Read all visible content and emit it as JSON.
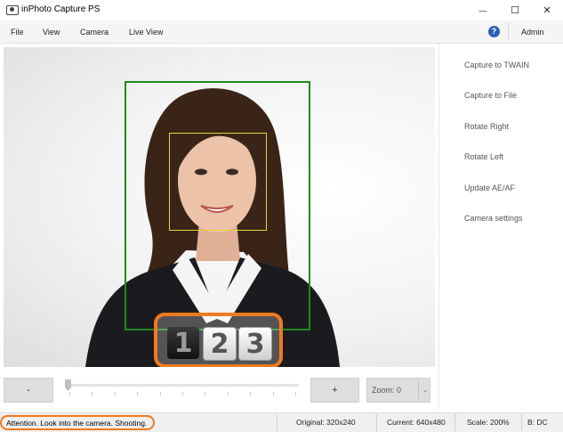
{
  "window": {
    "title": "inPhoto Capture PS",
    "minimize_glyph": "—",
    "maximize_glyph": "☐",
    "close_glyph": "✕"
  },
  "menu": {
    "items": [
      "File",
      "View",
      "Camera",
      "Live View"
    ],
    "help_icon": "help-icon",
    "help_glyph": "?",
    "admin_label": "Admin"
  },
  "preview": {
    "countdown_digits": [
      "1",
      "2",
      "3"
    ],
    "colors": {
      "face_frame": "#1e8a1e",
      "eyes_frame": "#e8d33a",
      "highlight": "#f07a1d"
    }
  },
  "side_panel": {
    "actions": [
      "Capture to TWAIN",
      "Capture to File",
      "Rotate Right",
      "Rotate Left",
      "Update AE/AF",
      "Camera settings"
    ]
  },
  "zoom": {
    "minus_label": "-",
    "plus_label": "+",
    "combo_label": "Zoom: 0",
    "combo_arrow": "⌄",
    "slider_value_fraction": 0.0
  },
  "status": {
    "message": "Attention. Look into the camera. Shooting.",
    "original": "Original: 320x240",
    "current": "Current: 640x480",
    "scale": "Scale: 200%",
    "mode": "B: DC"
  }
}
